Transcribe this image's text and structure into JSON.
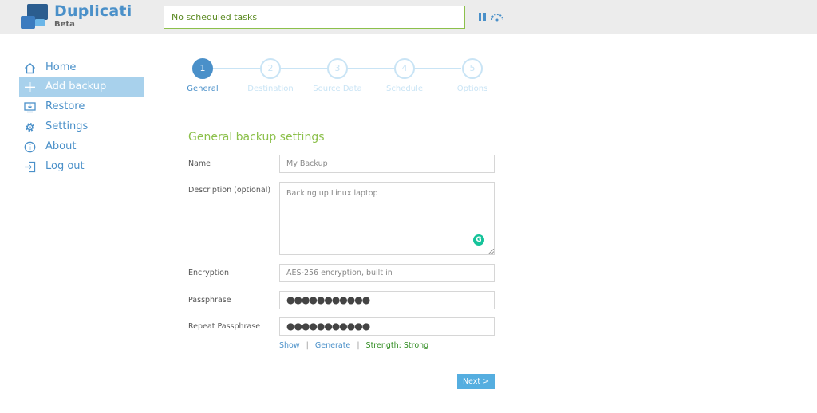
{
  "header": {
    "app_name": "Duplicati",
    "app_tag": "Beta",
    "status_text": "No scheduled tasks"
  },
  "colors": {
    "accent": "#4a90c9",
    "active_nav_bg": "#a8d1ec",
    "section_green": "#8cc04b",
    "strength_green": "#2e8b1f",
    "step_inactive": "#c9e4f5",
    "next_button": "#55aee0"
  },
  "sidebar": {
    "items": [
      {
        "label": "Home",
        "icon": "home-icon"
      },
      {
        "label": "Add backup",
        "icon": "plus-icon"
      },
      {
        "label": "Restore",
        "icon": "restore-icon"
      },
      {
        "label": "Settings",
        "icon": "gear-icon"
      },
      {
        "label": "About",
        "icon": "info-icon"
      },
      {
        "label": "Log out",
        "icon": "logout-icon"
      }
    ],
    "active_index": 1
  },
  "steps": [
    {
      "number": "1",
      "label": "General"
    },
    {
      "number": "2",
      "label": "Destination"
    },
    {
      "number": "3",
      "label": "Source Data"
    },
    {
      "number": "4",
      "label": "Schedule"
    },
    {
      "number": "5",
      "label": "Options"
    }
  ],
  "form": {
    "section_title": "General backup settings",
    "name_label": "Name",
    "name_value": "My Backup",
    "description_label": "Description (optional)",
    "description_value": "Backing up Linux laptop",
    "encryption_label": "Encryption",
    "encryption_value": "AES-256 encryption, built in",
    "passphrase_label": "Passphrase",
    "passphrase_value": "●●●●●●●●●●●",
    "repeat_label": "Repeat Passphrase",
    "repeat_value": "●●●●●●●●●●●",
    "show_link": "Show",
    "generate_link": "Generate",
    "separator": "|",
    "strength_text": "Strength: Strong",
    "next_label": "Next >"
  }
}
